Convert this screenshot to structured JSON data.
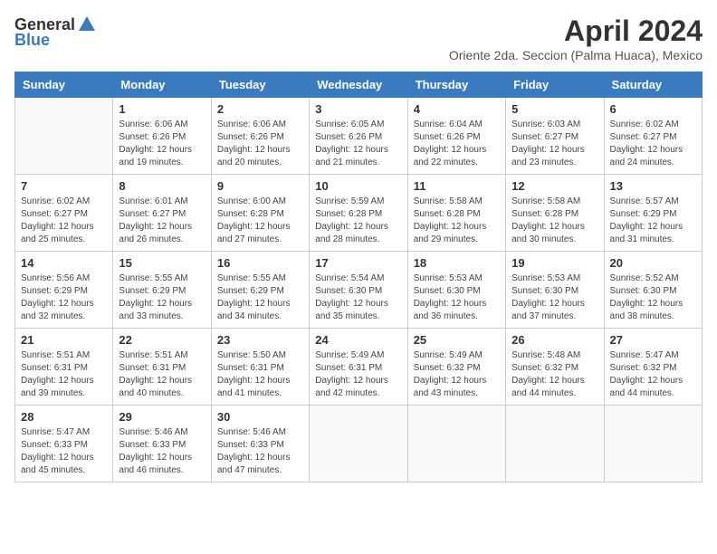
{
  "logo": {
    "general": "General",
    "blue": "Blue"
  },
  "title": "April 2024",
  "subtitle": "Oriente 2da. Seccion (Palma Huaca), Mexico",
  "weekdays": [
    "Sunday",
    "Monday",
    "Tuesday",
    "Wednesday",
    "Thursday",
    "Friday",
    "Saturday"
  ],
  "weeks": [
    [
      {
        "day": "",
        "sunrise": "",
        "sunset": "",
        "daylight": ""
      },
      {
        "day": "1",
        "sunrise": "Sunrise: 6:06 AM",
        "sunset": "Sunset: 6:26 PM",
        "daylight": "Daylight: 12 hours and 19 minutes."
      },
      {
        "day": "2",
        "sunrise": "Sunrise: 6:06 AM",
        "sunset": "Sunset: 6:26 PM",
        "daylight": "Daylight: 12 hours and 20 minutes."
      },
      {
        "day": "3",
        "sunrise": "Sunrise: 6:05 AM",
        "sunset": "Sunset: 6:26 PM",
        "daylight": "Daylight: 12 hours and 21 minutes."
      },
      {
        "day": "4",
        "sunrise": "Sunrise: 6:04 AM",
        "sunset": "Sunset: 6:26 PM",
        "daylight": "Daylight: 12 hours and 22 minutes."
      },
      {
        "day": "5",
        "sunrise": "Sunrise: 6:03 AM",
        "sunset": "Sunset: 6:27 PM",
        "daylight": "Daylight: 12 hours and 23 minutes."
      },
      {
        "day": "6",
        "sunrise": "Sunrise: 6:02 AM",
        "sunset": "Sunset: 6:27 PM",
        "daylight": "Daylight: 12 hours and 24 minutes."
      }
    ],
    [
      {
        "day": "7",
        "sunrise": "Sunrise: 6:02 AM",
        "sunset": "Sunset: 6:27 PM",
        "daylight": "Daylight: 12 hours and 25 minutes."
      },
      {
        "day": "8",
        "sunrise": "Sunrise: 6:01 AM",
        "sunset": "Sunset: 6:27 PM",
        "daylight": "Daylight: 12 hours and 26 minutes."
      },
      {
        "day": "9",
        "sunrise": "Sunrise: 6:00 AM",
        "sunset": "Sunset: 6:28 PM",
        "daylight": "Daylight: 12 hours and 27 minutes."
      },
      {
        "day": "10",
        "sunrise": "Sunrise: 5:59 AM",
        "sunset": "Sunset: 6:28 PM",
        "daylight": "Daylight: 12 hours and 28 minutes."
      },
      {
        "day": "11",
        "sunrise": "Sunrise: 5:58 AM",
        "sunset": "Sunset: 6:28 PM",
        "daylight": "Daylight: 12 hours and 29 minutes."
      },
      {
        "day": "12",
        "sunrise": "Sunrise: 5:58 AM",
        "sunset": "Sunset: 6:28 PM",
        "daylight": "Daylight: 12 hours and 30 minutes."
      },
      {
        "day": "13",
        "sunrise": "Sunrise: 5:57 AM",
        "sunset": "Sunset: 6:29 PM",
        "daylight": "Daylight: 12 hours and 31 minutes."
      }
    ],
    [
      {
        "day": "14",
        "sunrise": "Sunrise: 5:56 AM",
        "sunset": "Sunset: 6:29 PM",
        "daylight": "Daylight: 12 hours and 32 minutes."
      },
      {
        "day": "15",
        "sunrise": "Sunrise: 5:55 AM",
        "sunset": "Sunset: 6:29 PM",
        "daylight": "Daylight: 12 hours and 33 minutes."
      },
      {
        "day": "16",
        "sunrise": "Sunrise: 5:55 AM",
        "sunset": "Sunset: 6:29 PM",
        "daylight": "Daylight: 12 hours and 34 minutes."
      },
      {
        "day": "17",
        "sunrise": "Sunrise: 5:54 AM",
        "sunset": "Sunset: 6:30 PM",
        "daylight": "Daylight: 12 hours and 35 minutes."
      },
      {
        "day": "18",
        "sunrise": "Sunrise: 5:53 AM",
        "sunset": "Sunset: 6:30 PM",
        "daylight": "Daylight: 12 hours and 36 minutes."
      },
      {
        "day": "19",
        "sunrise": "Sunrise: 5:53 AM",
        "sunset": "Sunset: 6:30 PM",
        "daylight": "Daylight: 12 hours and 37 minutes."
      },
      {
        "day": "20",
        "sunrise": "Sunrise: 5:52 AM",
        "sunset": "Sunset: 6:30 PM",
        "daylight": "Daylight: 12 hours and 38 minutes."
      }
    ],
    [
      {
        "day": "21",
        "sunrise": "Sunrise: 5:51 AM",
        "sunset": "Sunset: 6:31 PM",
        "daylight": "Daylight: 12 hours and 39 minutes."
      },
      {
        "day": "22",
        "sunrise": "Sunrise: 5:51 AM",
        "sunset": "Sunset: 6:31 PM",
        "daylight": "Daylight: 12 hours and 40 minutes."
      },
      {
        "day": "23",
        "sunrise": "Sunrise: 5:50 AM",
        "sunset": "Sunset: 6:31 PM",
        "daylight": "Daylight: 12 hours and 41 minutes."
      },
      {
        "day": "24",
        "sunrise": "Sunrise: 5:49 AM",
        "sunset": "Sunset: 6:31 PM",
        "daylight": "Daylight: 12 hours and 42 minutes."
      },
      {
        "day": "25",
        "sunrise": "Sunrise: 5:49 AM",
        "sunset": "Sunset: 6:32 PM",
        "daylight": "Daylight: 12 hours and 43 minutes."
      },
      {
        "day": "26",
        "sunrise": "Sunrise: 5:48 AM",
        "sunset": "Sunset: 6:32 PM",
        "daylight": "Daylight: 12 hours and 44 minutes."
      },
      {
        "day": "27",
        "sunrise": "Sunrise: 5:47 AM",
        "sunset": "Sunset: 6:32 PM",
        "daylight": "Daylight: 12 hours and 44 minutes."
      }
    ],
    [
      {
        "day": "28",
        "sunrise": "Sunrise: 5:47 AM",
        "sunset": "Sunset: 6:33 PM",
        "daylight": "Daylight: 12 hours and 45 minutes."
      },
      {
        "day": "29",
        "sunrise": "Sunrise: 5:46 AM",
        "sunset": "Sunset: 6:33 PM",
        "daylight": "Daylight: 12 hours and 46 minutes."
      },
      {
        "day": "30",
        "sunrise": "Sunrise: 5:46 AM",
        "sunset": "Sunset: 6:33 PM",
        "daylight": "Daylight: 12 hours and 47 minutes."
      },
      {
        "day": "",
        "sunrise": "",
        "sunset": "",
        "daylight": ""
      },
      {
        "day": "",
        "sunrise": "",
        "sunset": "",
        "daylight": ""
      },
      {
        "day": "",
        "sunrise": "",
        "sunset": "",
        "daylight": ""
      },
      {
        "day": "",
        "sunrise": "",
        "sunset": "",
        "daylight": ""
      }
    ]
  ]
}
